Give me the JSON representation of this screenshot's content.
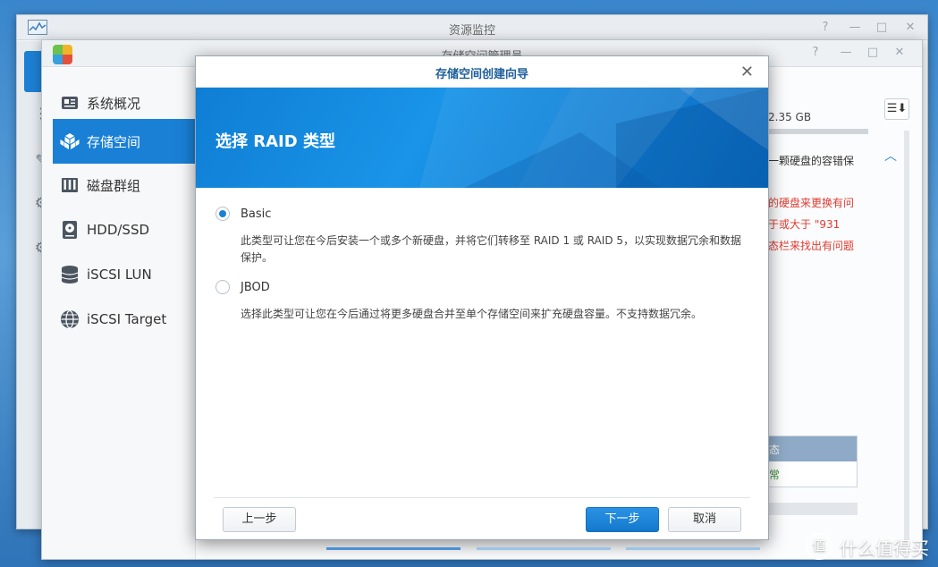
{
  "back_window": {
    "title": "资源监控",
    "controls": [
      "?",
      "—",
      "□",
      "✕"
    ]
  },
  "mid_window": {
    "title": "存储空间管理员",
    "controls": [
      "?",
      "—",
      "□",
      "✕"
    ],
    "sidebar": [
      {
        "label": "系统概况",
        "icon": "overview-icon"
      },
      {
        "label": "存储空间",
        "icon": "storage-icon"
      },
      {
        "label": "磁盘群组",
        "icon": "disk-group-icon"
      },
      {
        "label": "HDD/SSD",
        "icon": "hdd-icon"
      },
      {
        "label": "iSCSI LUN",
        "icon": "database-icon"
      },
      {
        "label": "iSCSI Target",
        "icon": "globe-icon"
      }
    ],
    "right_panel": {
      "sort_button": "☰⬇",
      "size_text": "2.35 GB",
      "line1": "一颗硬盘的容错保",
      "red1": "的硬盘来更换有问",
      "red2": "于或大于 \"931",
      "red3": "态栏来找出有问题",
      "table_header": "态",
      "table_value": "常"
    }
  },
  "dialog": {
    "title": "存储空间创建向导",
    "close": "✕",
    "banner_title": "选择 RAID 类型",
    "options": [
      {
        "label": "Basic",
        "selected": true,
        "desc": "此类型可让您在今后安装一个或多个新硬盘，并将它们转移至 RAID 1 或 RAID 5，以实现数据冗余和数据保护。"
      },
      {
        "label": "JBOD",
        "selected": false,
        "desc": "选择此类型可让您在今后通过将更多硬盘合并至单个存储空间来扩充硬盘容量。不支持数据冗余。"
      }
    ],
    "buttons": {
      "back": "上一步",
      "next": "下一步",
      "cancel": "取消"
    }
  },
  "watermark": {
    "text": "什么值得买",
    "icon": "值"
  },
  "colors": {
    "accent": "#1a80d6",
    "error": "#e03c31",
    "desktop": "#3a86cc"
  }
}
